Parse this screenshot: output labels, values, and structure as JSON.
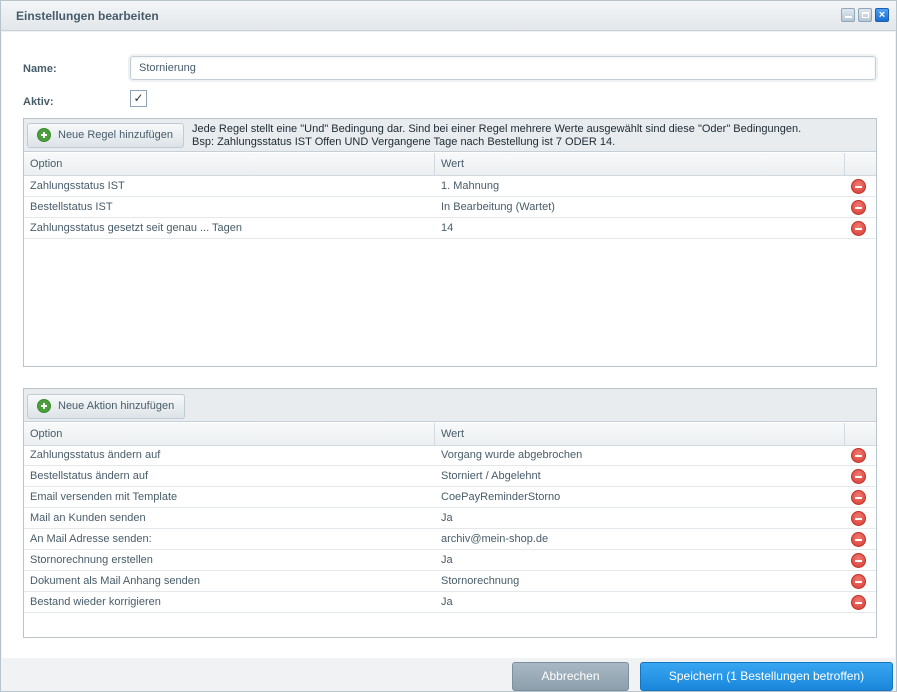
{
  "window": {
    "title": "Einstellungen bearbeiten",
    "close_glyph": "×"
  },
  "form": {
    "name_label": "Name:",
    "name_value": "Stornierung",
    "active_label": "Aktiv:",
    "active_checked": true,
    "check_glyph": "✓"
  },
  "rules": {
    "add_button": "Neue Regel hinzufügen",
    "hint_line1": "Jede Regel stellt eine \"Und\" Bedingung dar. Sind bei einer Regel mehrere Werte ausgewählt sind diese \"Oder\" Bedingungen.",
    "hint_line2": "Bsp: Zahlungsstatus IST Offen UND Vergangene Tage nach Bestellung ist 7 ODER 14.",
    "columns": [
      "Option",
      "Wert"
    ],
    "rows": [
      {
        "option": "Zahlungsstatus IST",
        "value": "1. Mahnung"
      },
      {
        "option": "Bestellstatus IST",
        "value": "In Bearbeitung (Wartet)"
      },
      {
        "option": "Zahlungsstatus gesetzt seit genau ... Tagen",
        "value": "14"
      }
    ]
  },
  "actions": {
    "add_button": "Neue Aktion hinzufügen",
    "columns": [
      "Option",
      "Wert"
    ],
    "rows": [
      {
        "option": "Zahlungsstatus ändern auf",
        "value": "Vorgang wurde abgebrochen"
      },
      {
        "option": "Bestellstatus ändern auf",
        "value": "Storniert / Abgelehnt"
      },
      {
        "option": "Email versenden mit Template",
        "value": "CoePayReminderStorno"
      },
      {
        "option": "Mail an Kunden senden",
        "value": "Ja"
      },
      {
        "option": "An Mail Adresse senden:",
        "value": "archiv@mein-shop.de"
      },
      {
        "option": "Stornorechnung erstellen",
        "value": "Ja"
      },
      {
        "option": "Dokument als Mail Anhang senden",
        "value": "Stornorechnung"
      },
      {
        "option": "Bestand wieder korrigieren",
        "value": "Ja"
      }
    ]
  },
  "footer": {
    "cancel_label": "Abbrechen",
    "save_label": "Speichern (1 Bestellungen betroffen)"
  },
  "colors": {
    "accent": "#1a86da",
    "add_icon": "#4a9f3c",
    "remove_icon": "#d63b32"
  },
  "icons": {
    "add": "plus-circle-icon",
    "remove": "minus-circle-icon",
    "check": "checkmark-icon"
  }
}
